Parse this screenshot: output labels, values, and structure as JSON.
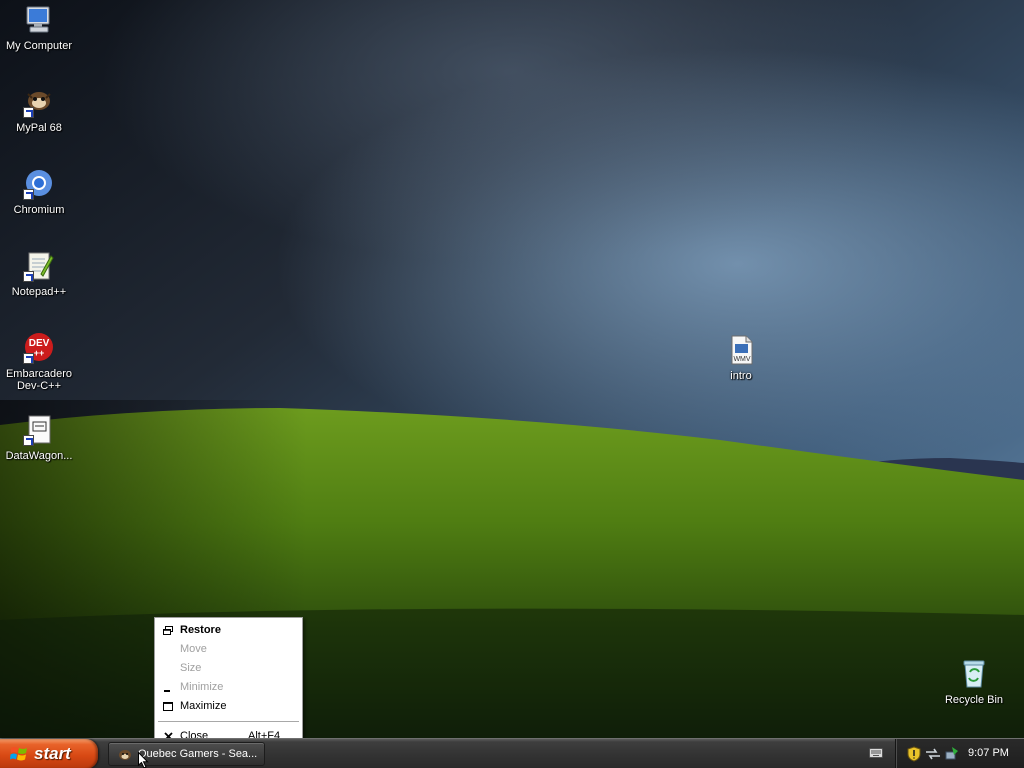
{
  "desktop": {
    "icons": [
      {
        "label": "My Computer",
        "icon": "my-computer-icon"
      },
      {
        "label": "MyPal 68",
        "icon": "mypal-browser-icon"
      },
      {
        "label": "Chromium",
        "icon": "chromium-icon"
      },
      {
        "label": "Notepad++",
        "icon": "notepad-plus-plus-icon"
      },
      {
        "label": "Embarcadero Dev-C++",
        "icon": "dev-cpp-icon",
        "badge": "DEV"
      },
      {
        "label": "DataWagon...",
        "icon": "datawagon-icon"
      },
      {
        "label": "intro",
        "icon": "wmv-file-icon",
        "badge": "WMV"
      },
      {
        "label": "Recycle Bin",
        "icon": "recycle-bin-icon"
      }
    ]
  },
  "context_menu": {
    "items": [
      {
        "label": "Restore",
        "enabled": true,
        "default": true,
        "icon": "restore-icon"
      },
      {
        "label": "Move",
        "enabled": false
      },
      {
        "label": "Size",
        "enabled": false
      },
      {
        "label": "Minimize",
        "enabled": false,
        "icon": "minimize-icon"
      },
      {
        "label": "Maximize",
        "enabled": true,
        "icon": "maximize-icon"
      },
      {
        "label": "Close",
        "enabled": true,
        "icon": "close-icon",
        "shortcut": "Alt+F4"
      }
    ]
  },
  "taskbar": {
    "start_label": "start",
    "task_button_label": "Quebec Gamers - Sea...",
    "clock": "9:07 PM",
    "tray_icons": [
      "security-shield-icon",
      "network-icon",
      "safely-remove-icon"
    ],
    "colors": {
      "start": "#d84914",
      "bar": "#343434"
    }
  }
}
